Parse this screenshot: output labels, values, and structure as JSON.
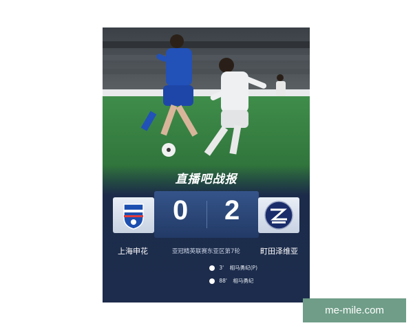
{
  "brand": {
    "title": "直播吧战报"
  },
  "match": {
    "home_team": "上海申花",
    "away_team": "町田泽维亚",
    "home_score": "0",
    "away_score": "2",
    "competition": "亚冠精英联赛东亚区第7轮"
  },
  "goals": [
    {
      "minute": "3'",
      "scorer": "相马勇纪(P)"
    },
    {
      "minute": "88'",
      "scorer": "相马勇纪"
    }
  ],
  "watermark": {
    "text": "me-mile.com"
  },
  "colors": {
    "card_bg": "#1c2b4a",
    "score_panel": "#2b4677",
    "accent": "#2fd0b4"
  }
}
